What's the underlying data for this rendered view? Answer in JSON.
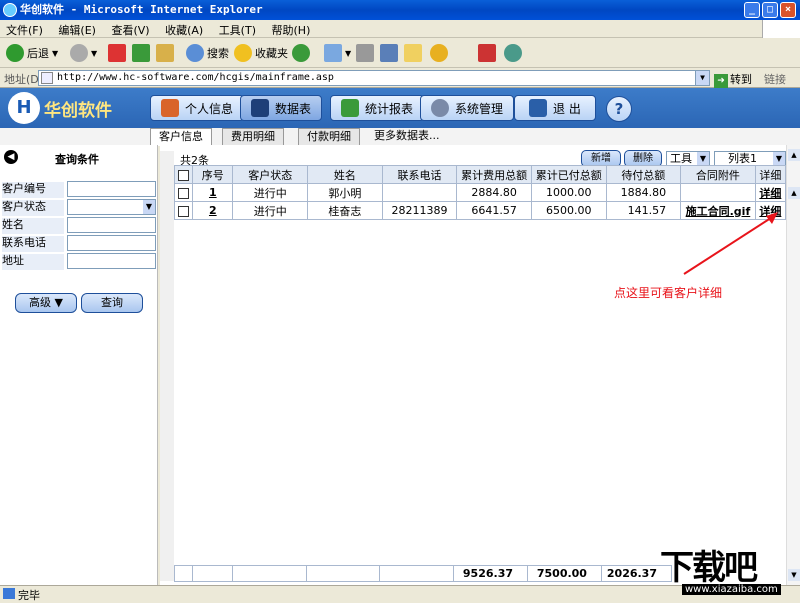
{
  "window": {
    "title": "华创软件 - Microsoft Internet Explorer"
  },
  "menu": [
    "文件(F)",
    "编辑(E)",
    "查看(V)",
    "收藏(A)",
    "工具(T)",
    "帮助(H)"
  ],
  "toolbar": {
    "back": "后退",
    "search": "搜索",
    "favorites": "收藏夹"
  },
  "address": {
    "label": "地址(D)",
    "url": "http://www.hc-software.com/hcgis/mainframe.asp",
    "go": "转到",
    "links": "链接"
  },
  "app": {
    "logo": "华创软件",
    "nav": [
      "个人信息",
      "数据表",
      "统计报表",
      "系统管理",
      "退 出"
    ],
    "help": "?"
  },
  "tabs": [
    "客户信息",
    "费用明细",
    "付款明细",
    "更多数据表..."
  ],
  "sidebar": {
    "title": "查询条件",
    "fields": [
      "客户编号",
      "客户状态",
      "姓名",
      "联系电话",
      "地址"
    ],
    "advanced": "高级 ▼",
    "query": "查询"
  },
  "grid": {
    "count": "共2条",
    "new_btn": "新增",
    "delete_btn": "删除",
    "tools_select": "工具",
    "list_select": "列表1",
    "headers": [
      "序号",
      "客户状态",
      "姓名",
      "联系电话",
      "累计费用总额",
      "累计已付总额",
      "待付总额",
      "合同附件",
      "详细"
    ],
    "rows": [
      {
        "no": "1",
        "status": "进行中",
        "name": "郭小明",
        "phone": "",
        "total": "2884.80",
        "paid": "1000.00",
        "due": "1884.80",
        "attach": "",
        "detail": "详细"
      },
      {
        "no": "2",
        "status": "进行中",
        "name": "桂奋志",
        "phone": "28211389",
        "total": "6641.57",
        "paid": "6500.00",
        "due": "141.57",
        "attach": "施工合同.gif",
        "detail": "详细"
      }
    ],
    "totals": {
      "total": "9526.37",
      "paid": "7500.00",
      "due": "2026.37"
    }
  },
  "annotation": "点这里可看客户详细",
  "status": "完毕",
  "watermark": {
    "big": "下载吧",
    "small": "www.xiazaiba.com"
  }
}
